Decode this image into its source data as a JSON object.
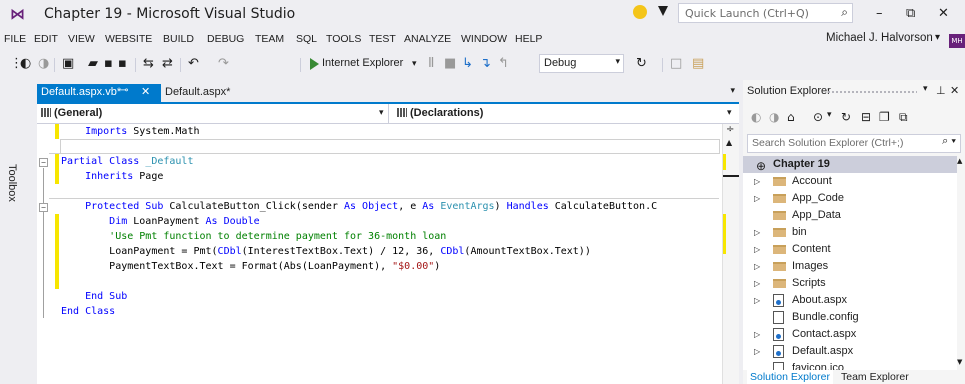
{
  "window": {
    "title": "Chapter 19 - Microsoft Visual Studio",
    "quick_launch_placeholder": "Quick Launch (Ctrl+Q)",
    "minimize": "–",
    "restore": "⧉",
    "close": "✕"
  },
  "menu": {
    "items": [
      "FILE",
      "EDIT",
      "VIEW",
      "WEBSITE",
      "BUILD",
      "DEBUG",
      "TEAM",
      "SQL",
      "TOOLS",
      "TEST",
      "ANALYZE",
      "WINDOW",
      "HELP"
    ],
    "user": "Michael J. Halvorson",
    "user_badge": "MH"
  },
  "toolbar": {
    "browser": "Internet Explorer",
    "configuration": "Debug"
  },
  "toolbox": {
    "label": "Toolbox"
  },
  "editor": {
    "tabs": {
      "active": "Default.aspx.vb*",
      "inactive": "Default.aspx*"
    },
    "nav": {
      "left": "(General)",
      "right": "(Declarations)"
    },
    "lines": [
      {
        "indent": "    ",
        "parts": [
          {
            "t": "Imports",
            "c": "kw"
          },
          {
            "t": " System.Math",
            "c": ""
          }
        ]
      },
      {
        "indent": "",
        "parts": []
      },
      {
        "indent": "",
        "parts": [
          {
            "t": "Partial Class",
            "c": "kw"
          },
          {
            "t": " ",
            "c": ""
          },
          {
            "t": "_Default",
            "c": "type"
          }
        ]
      },
      {
        "indent": "    ",
        "parts": [
          {
            "t": "Inherits",
            "c": "kw"
          },
          {
            "t": " Page",
            "c": ""
          }
        ]
      },
      {
        "indent": "",
        "parts": []
      },
      {
        "indent": "    ",
        "parts": [
          {
            "t": "Protected Sub",
            "c": "kw"
          },
          {
            "t": " CalculateButton_Click(sender ",
            "c": ""
          },
          {
            "t": "As Object",
            "c": "kw"
          },
          {
            "t": ", e ",
            "c": ""
          },
          {
            "t": "As",
            "c": "kw"
          },
          {
            "t": " ",
            "c": ""
          },
          {
            "t": "EventArgs",
            "c": "type"
          },
          {
            "t": ") ",
            "c": ""
          },
          {
            "t": "Handles",
            "c": "kw"
          },
          {
            "t": " CalculateButton.C",
            "c": ""
          }
        ]
      },
      {
        "indent": "        ",
        "parts": [
          {
            "t": "Dim",
            "c": "kw"
          },
          {
            "t": " LoanPayment ",
            "c": ""
          },
          {
            "t": "As Double",
            "c": "kw"
          }
        ]
      },
      {
        "indent": "        ",
        "parts": [
          {
            "t": "'Use Pmt function to determine payment for 36-month loan",
            "c": "cmt"
          }
        ]
      },
      {
        "indent": "        ",
        "parts": [
          {
            "t": "LoanPayment = Pmt(",
            "c": ""
          },
          {
            "t": "CDbl",
            "c": "kw"
          },
          {
            "t": "(InterestTextBox.Text) / 12, 36, ",
            "c": ""
          },
          {
            "t": "CDbl",
            "c": "kw"
          },
          {
            "t": "(AmountTextBox.Text))",
            "c": ""
          }
        ]
      },
      {
        "indent": "        ",
        "parts": [
          {
            "t": "PaymentTextBox.Text = Format(Abs(LoanPayment), ",
            "c": ""
          },
          {
            "t": "\"$0.00\"",
            "c": "str"
          },
          {
            "t": ")",
            "c": ""
          }
        ]
      },
      {
        "indent": "",
        "parts": []
      },
      {
        "indent": "    ",
        "parts": [
          {
            "t": "End Sub",
            "c": "kw"
          }
        ]
      },
      {
        "indent": "",
        "parts": [
          {
            "t": "End Class",
            "c": "kw"
          }
        ]
      }
    ]
  },
  "solution_explorer": {
    "title": "Solution Explorer",
    "search_placeholder": "Search Solution Explorer (Ctrl+;)",
    "project": "Chapter 19",
    "items": [
      {
        "label": "Account",
        "kind": "folder",
        "expandable": true
      },
      {
        "label": "App_Code",
        "kind": "folder",
        "expandable": true
      },
      {
        "label": "App_Data",
        "kind": "folder",
        "expandable": false
      },
      {
        "label": "bin",
        "kind": "folder",
        "expandable": true
      },
      {
        "label": "Content",
        "kind": "folder",
        "expandable": true
      },
      {
        "label": "Images",
        "kind": "folder",
        "expandable": true
      },
      {
        "label": "Scripts",
        "kind": "folder",
        "expandable": true
      },
      {
        "label": "About.aspx",
        "kind": "page",
        "expandable": true
      },
      {
        "label": "Bundle.config",
        "kind": "config",
        "expandable": false
      },
      {
        "label": "Contact.aspx",
        "kind": "page",
        "expandable": true
      },
      {
        "label": "Default.aspx",
        "kind": "page",
        "expandable": true
      },
      {
        "label": "favicon.ico",
        "kind": "config",
        "expandable": false
      }
    ],
    "bottom_tabs": [
      "Solution Explorer",
      "Team Explorer"
    ]
  },
  "colors": {
    "accent": "#007acc",
    "vs_purple": "#68217a",
    "change_marker": "#f7e600"
  }
}
